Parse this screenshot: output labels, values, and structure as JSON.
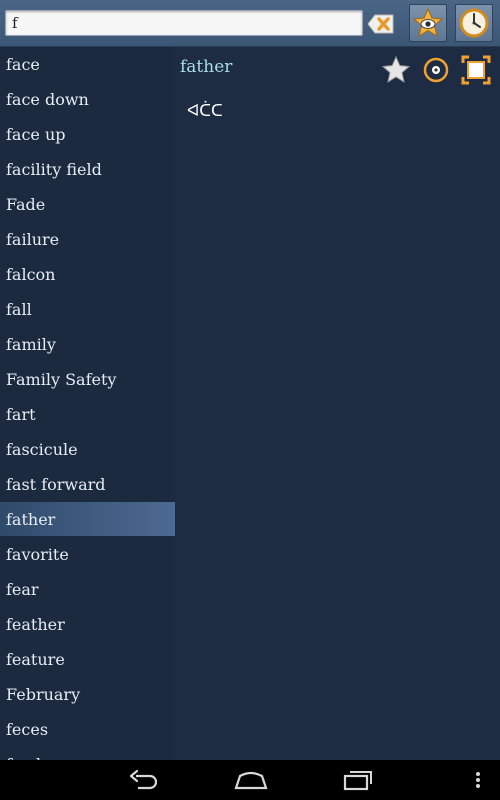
{
  "search": {
    "value": "f",
    "placeholder": ""
  },
  "toolbar": {
    "clear_icon": "clear-text-icon",
    "favorites_icon": "star-eye-icon",
    "history_icon": "clock-icon"
  },
  "word_list": {
    "items": [
      "face",
      "face down",
      "face up",
      "facility field",
      "Fade",
      "failure",
      "falcon",
      "fall",
      "family",
      "Family Safety",
      "fart",
      "fascicule",
      "fast forward",
      "father",
      "favorite",
      "fear",
      "feather",
      "feature",
      "February",
      "feces",
      "feed"
    ],
    "selected": "father"
  },
  "detail": {
    "word": "father",
    "translation": "ᐊᑖᑕ",
    "icons": [
      "star-icon",
      "speaker-icon",
      "expand-icon"
    ]
  },
  "navbar": {
    "icons": [
      "back-icon",
      "home-icon",
      "recent-apps-icon",
      "menu-icon"
    ]
  },
  "colors": {
    "list_bg": "#1b2a3f",
    "selected_bg": "#4d6a92",
    "word_accent": "#a7dde8",
    "icon_orange": "#f0a030"
  }
}
